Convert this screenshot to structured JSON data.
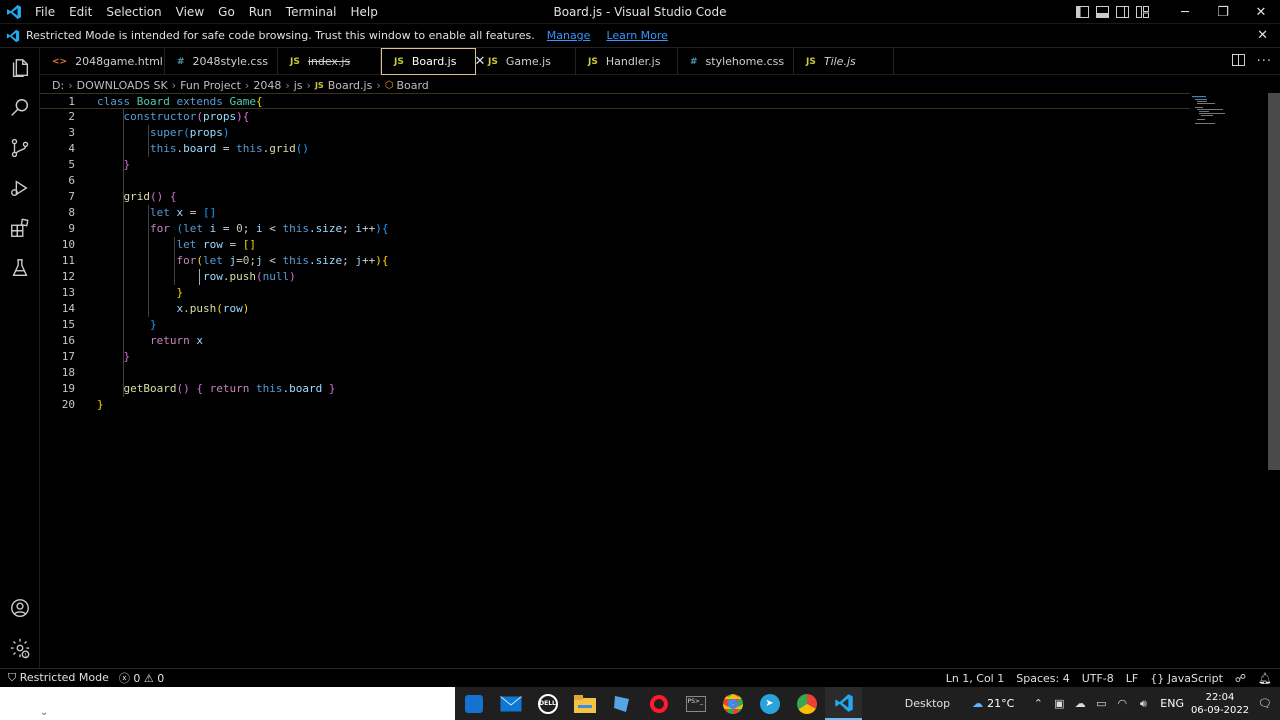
{
  "titlebar": {
    "menu": [
      "File",
      "Edit",
      "Selection",
      "View",
      "Go",
      "Run",
      "Terminal",
      "Help"
    ],
    "title": "Board.js - Visual Studio Code"
  },
  "banner": {
    "message": "Restricted Mode is intended for safe code browsing. Trust this window to enable all features.",
    "manage": "Manage",
    "learn_more": "Learn More"
  },
  "tabs": [
    {
      "icon": "<>",
      "kind": "html",
      "label": "2048game.html"
    },
    {
      "icon": "#",
      "kind": "css",
      "label": "2048style.css"
    },
    {
      "icon": "JS",
      "kind": "js",
      "label": "index.js"
    },
    {
      "icon": "JS",
      "kind": "js",
      "label": "Board.js"
    },
    {
      "icon": "JS",
      "kind": "js",
      "label": "Game.js"
    },
    {
      "icon": "JS",
      "kind": "js",
      "label": "Handler.js"
    },
    {
      "icon": "#",
      "kind": "css",
      "label": "stylehome.css"
    },
    {
      "icon": "JS",
      "kind": "js",
      "label": "Tile.js"
    }
  ],
  "breadcrumb": [
    "D:",
    "DOWNLOADS SK",
    "Fun Project",
    "2048",
    "js",
    "Board.js",
    "Board"
  ],
  "editor": {
    "line_numbers": [
      "1",
      "2",
      "3",
      "4",
      "5",
      "6",
      "7",
      "8",
      "9",
      "10",
      "11",
      "12",
      "13",
      "14",
      "15",
      "16",
      "17",
      "18",
      "19",
      "20"
    ]
  },
  "statusbar": {
    "mode": "Restricted Mode",
    "errors": "0",
    "warnings": "0",
    "position": "Ln 1, Col 1",
    "spaces": "Spaces: 4",
    "encoding": "UTF-8",
    "eol": "LF",
    "language": "JavaScript"
  },
  "taskbar": {
    "desktop_label": "Desktop",
    "temperature": "21°C",
    "language": "ENG",
    "time": "22:04",
    "date": "06-09-2022"
  },
  "colors": {
    "active_tab_border": "#e2c08d",
    "link": "#3794ff",
    "vscode_blue": "#23a9f2"
  }
}
